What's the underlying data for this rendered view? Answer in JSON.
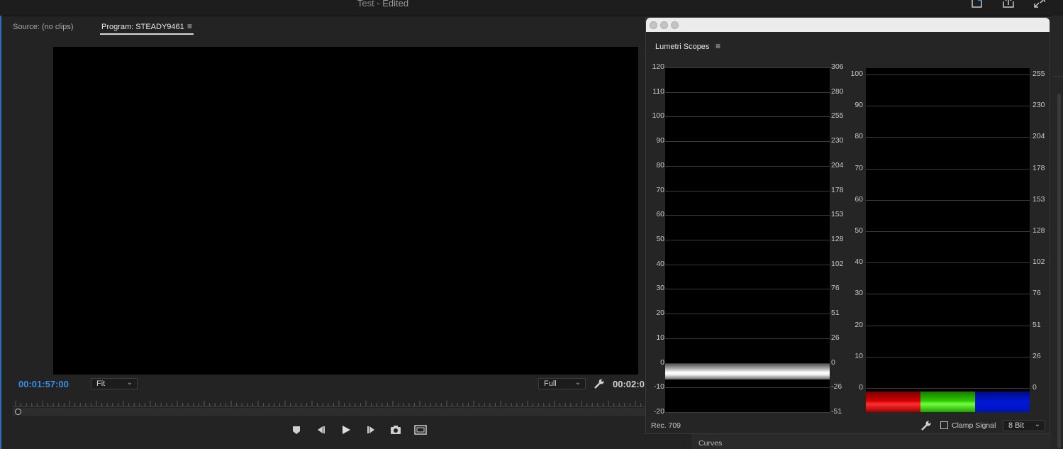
{
  "app": {
    "title": "Test",
    "title_suffix": " - Edited"
  },
  "tabs": {
    "source": "Source: (no clips)",
    "program": "Program: STEADY9461"
  },
  "monitor": {
    "timecode_current": "00:01:57:00",
    "timecode_duration": "00:02:0",
    "zoom": "Fit",
    "resolution": "Full"
  },
  "transport": [
    "marker-icon",
    "step-back-icon",
    "play-icon",
    "step-forward-icon",
    "camera-icon",
    "safe-margins-icon"
  ],
  "scopes": {
    "title": "Lumetri Scopes",
    "waveform": {
      "left_ticks": [
        "120",
        "110",
        "100",
        "90",
        "80",
        "70",
        "60",
        "50",
        "40",
        "30",
        "20",
        "10",
        "0",
        "-10",
        "-20"
      ],
      "right_ticks": [
        "306",
        "280",
        "255",
        "230",
        "204",
        "178",
        "153",
        "128",
        "102",
        "76",
        "51",
        "26",
        "0",
        "-26",
        "-51"
      ]
    },
    "parade": {
      "left_ticks": [
        "100",
        "90",
        "80",
        "70",
        "60",
        "50",
        "40",
        "30",
        "20",
        "10",
        "0"
      ],
      "right_ticks": [
        "255",
        "230",
        "204",
        "178",
        "153",
        "128",
        "102",
        "76",
        "51",
        "26",
        "0"
      ],
      "colors": [
        "#c00000",
        "#22c000",
        "#0018d8"
      ]
    },
    "colorspace": "Rec. 709",
    "clamp_label": "Clamp Signal",
    "bit_depth": "8 Bit"
  },
  "bottom_panel": {
    "label": "Curves"
  }
}
